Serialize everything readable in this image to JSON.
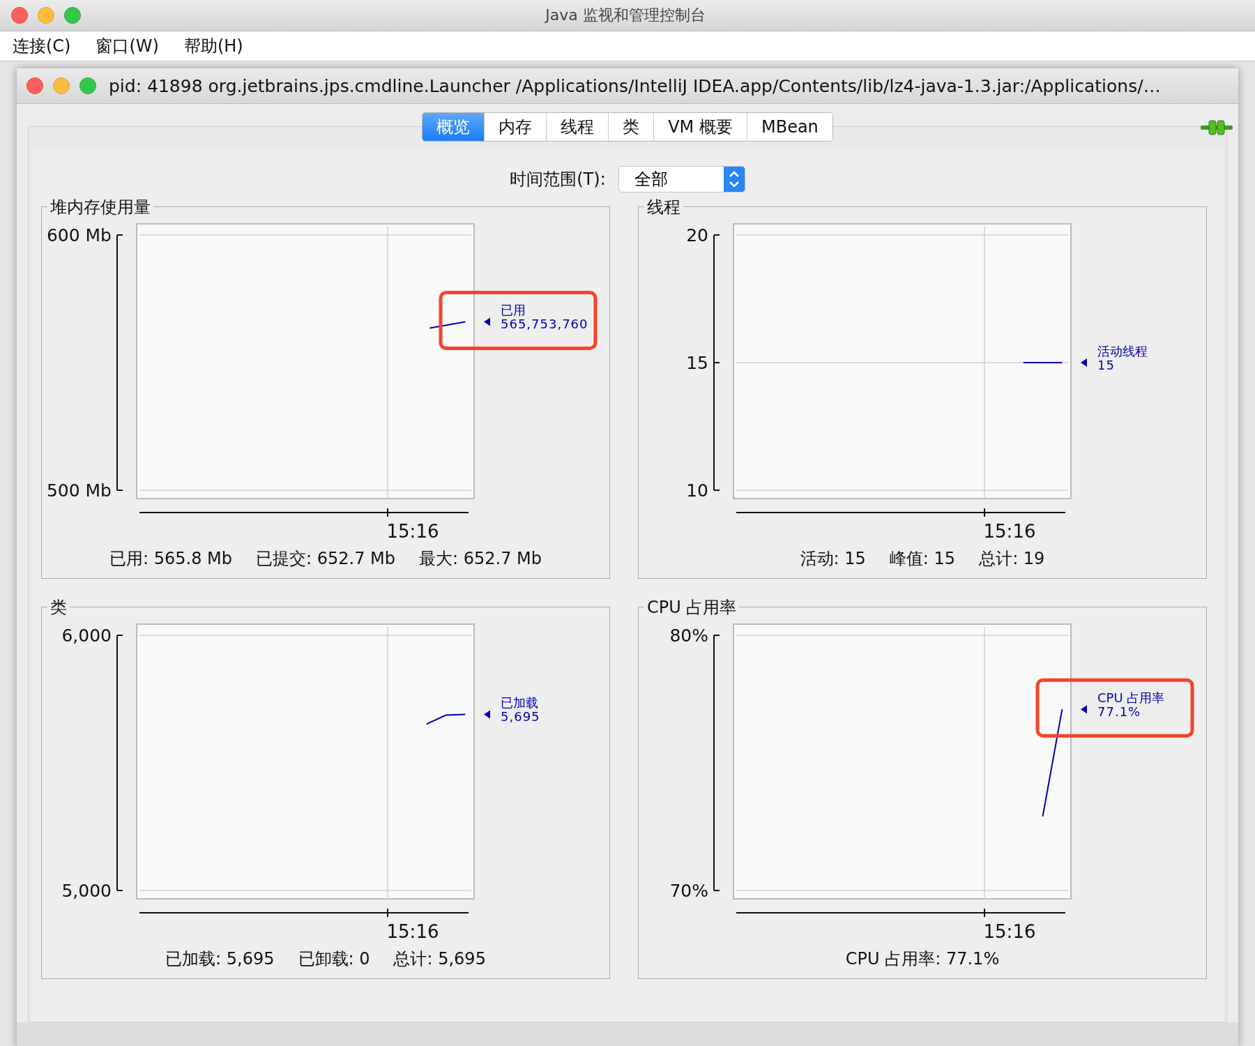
{
  "window": {
    "title": "Java 监视和管理控制台"
  },
  "menu": [
    "连接(C)",
    "窗口(W)",
    "帮助(H)"
  ],
  "connection_window": {
    "title": "pid: 41898 org.jetbrains.jps.cmdline.Launcher /Applications/IntelliJ IDEA.app/Contents/lib/lz4-java-1.3.jar:/Applications/…"
  },
  "tabs": [
    {
      "label": "概览",
      "selected": true
    },
    {
      "label": "内存",
      "selected": false
    },
    {
      "label": "线程",
      "selected": false
    },
    {
      "label": "类",
      "selected": false
    },
    {
      "label": "VM 概要",
      "selected": false
    },
    {
      "label": "MBean",
      "selected": false
    }
  ],
  "time_range": {
    "label": "时间范围(T):",
    "value": "全部"
  },
  "panels": [
    {
      "title": "堆内存使用量",
      "y_ticks": [
        "600 Mb",
        "500 Mb"
      ],
      "x_tick": "15:16",
      "legend_name": "已用",
      "legend_value": "565,753,760",
      "highlighted": true,
      "summary": [
        "已用: 565.8 Mb",
        "已提交: 652.7 Mb",
        "最大: 652.7 Mb"
      ]
    },
    {
      "title": "线程",
      "y_ticks": [
        "20",
        "15",
        "10"
      ],
      "x_tick": "15:16",
      "legend_name": "活动线程",
      "legend_value": "15",
      "highlighted": false,
      "summary": [
        "活动: 15",
        "峰值: 15",
        "总计: 19"
      ]
    },
    {
      "title": "类",
      "y_ticks": [
        "6,000",
        "5,000"
      ],
      "x_tick": "15:16",
      "legend_name": "已加载",
      "legend_value": "5,695",
      "highlighted": false,
      "summary": [
        "已加载: 5,695",
        "已卸载: 0",
        "总计: 5,695"
      ]
    },
    {
      "title": "CPU 占用率",
      "y_ticks": [
        "80%",
        "70%"
      ],
      "x_tick": "15:16",
      "legend_name": "CPU 占用率",
      "legend_value": "77.1%",
      "highlighted": true,
      "summary": [
        "CPU 占用率: 77.1%"
      ]
    }
  ]
}
